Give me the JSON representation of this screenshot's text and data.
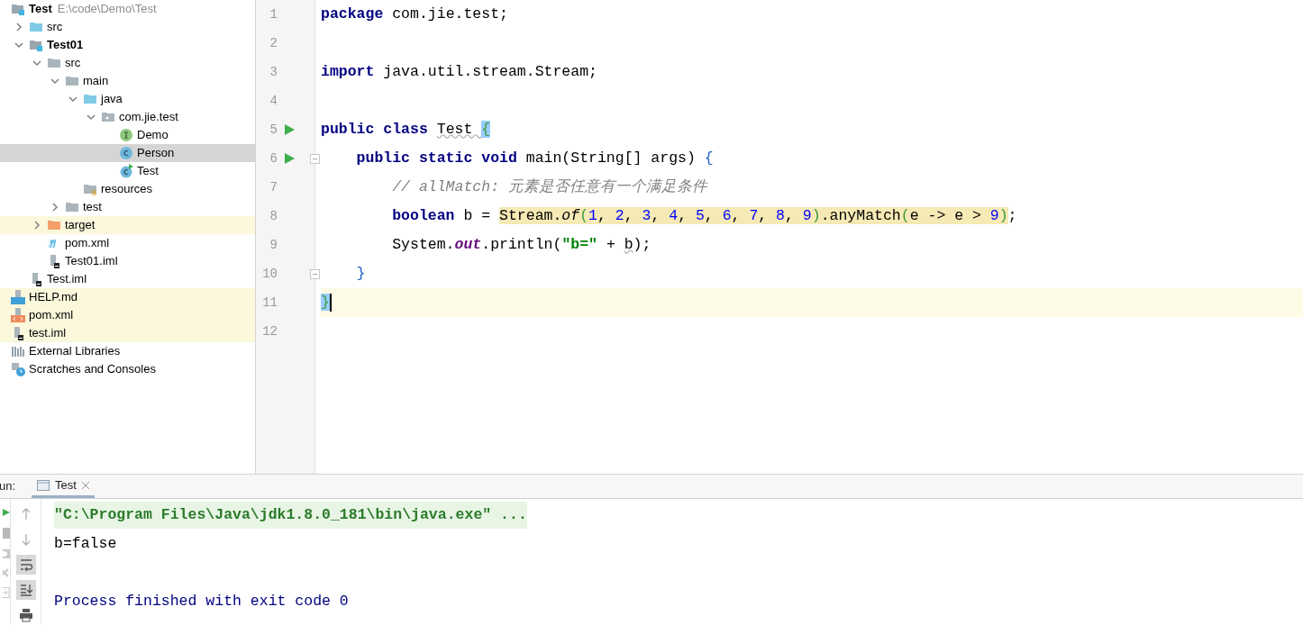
{
  "project_tree": [
    {
      "label": "Test",
      "kind": "module",
      "bold": true,
      "hint": "E:\\code\\Demo\\Test",
      "selected": false,
      "highlighted": false,
      "children": [
        {
          "label": "src",
          "kind": "source-folder",
          "bold": false,
          "expanded": false,
          "selected": false,
          "highlighted": false
        },
        {
          "label": "Test01",
          "kind": "module",
          "bold": true,
          "expanded": true,
          "selected": false,
          "highlighted": false,
          "children": [
            {
              "label": "src",
              "kind": "folder",
              "bold": false,
              "expanded": true,
              "selected": false,
              "highlighted": false,
              "children": [
                {
                  "label": "main",
                  "kind": "folder",
                  "bold": false,
                  "expanded": true,
                  "selected": false,
                  "highlighted": false,
                  "children": [
                    {
                      "label": "java",
                      "kind": "source-folder",
                      "bold": false,
                      "expanded": true,
                      "selected": false,
                      "highlighted": false,
                      "children": [
                        {
                          "label": "com.jie.test",
                          "kind": "package",
                          "bold": false,
                          "expanded": true,
                          "selected": false,
                          "highlighted": false,
                          "children": [
                            {
                              "label": "Demo",
                              "kind": "interface",
                              "bold": false,
                              "selected": false,
                              "highlighted": false
                            },
                            {
                              "label": "Person",
                              "kind": "class",
                              "bold": false,
                              "selected": true,
                              "highlighted": false
                            },
                            {
                              "label": "Test",
                              "kind": "class-run",
                              "bold": false,
                              "selected": false,
                              "highlighted": false
                            }
                          ]
                        }
                      ]
                    },
                    {
                      "label": "resources",
                      "kind": "resources",
                      "bold": false,
                      "selected": false,
                      "highlighted": false
                    }
                  ]
                },
                {
                  "label": "test",
                  "kind": "folder",
                  "bold": false,
                  "expanded": false,
                  "selected": false,
                  "highlighted": false
                }
              ]
            },
            {
              "label": "target",
              "kind": "excluded-folder",
              "bold": false,
              "expanded": false,
              "selected": false,
              "highlighted": true
            },
            {
              "label": "pom.xml",
              "kind": "maven",
              "bold": false,
              "selected": false,
              "highlighted": false
            },
            {
              "label": "Test01.iml",
              "kind": "iml",
              "bold": false,
              "selected": false,
              "highlighted": false
            }
          ]
        },
        {
          "label": "Test.iml",
          "kind": "iml",
          "bold": false,
          "selected": false,
          "highlighted": false
        }
      ]
    },
    {
      "label": "HELP.md",
      "kind": "markdown",
      "bold": false,
      "selected": false,
      "highlighted": true
    },
    {
      "label": "pom.xml",
      "kind": "xml",
      "bold": false,
      "selected": false,
      "highlighted": true
    },
    {
      "label": "test.iml",
      "kind": "iml",
      "bold": false,
      "selected": false,
      "highlighted": true
    },
    {
      "label": "External Libraries",
      "kind": "libraries",
      "bold": false,
      "selected": false,
      "highlighted": false
    },
    {
      "label": "Scratches and Consoles",
      "kind": "scratches",
      "bold": false,
      "selected": false,
      "highlighted": false
    }
  ],
  "editor": {
    "lines": [
      {
        "number": "1",
        "run": false,
        "fold": false,
        "current": false,
        "tokens": [
          {
            "kind": "kw",
            "text": "package "
          },
          {
            "kind": "plain",
            "text": "com.jie.test;"
          }
        ]
      },
      {
        "number": "2",
        "run": false,
        "fold": false,
        "current": false
      },
      {
        "number": "3",
        "run": false,
        "fold": false,
        "current": false,
        "tokens": [
          {
            "kind": "kw",
            "text": "import "
          },
          {
            "kind": "plain",
            "text": "java.util.stream.Stream;"
          }
        ]
      },
      {
        "number": "4",
        "run": false,
        "fold": false,
        "current": false
      },
      {
        "number": "5",
        "run": true,
        "fold": false,
        "current": false,
        "tokens": [
          {
            "kind": "kw",
            "text": "public class "
          },
          {
            "kind": "warn",
            "text": "Test "
          },
          {
            "kind": "brace-match",
            "text": "{"
          }
        ]
      },
      {
        "number": "6",
        "run": true,
        "fold": true,
        "current": false,
        "tokens": [
          {
            "kind": "kw",
            "text": "    public static void"
          },
          {
            "kind": "plain",
            "text": " main(String[] args) "
          },
          {
            "kind": "blue",
            "text": "{"
          }
        ]
      },
      {
        "number": "7",
        "run": false,
        "fold": false,
        "current": false,
        "tokens": [
          {
            "kind": "comment",
            "text": "        // allMatch: 元素是否任意有一个满足条件"
          }
        ]
      },
      {
        "number": "8",
        "run": false,
        "fold": false,
        "current": false,
        "tokens": [
          {
            "kind": "kw",
            "text": "        boolean"
          },
          {
            "kind": "plain",
            "text": " b = "
          },
          {
            "kind": "highlighted",
            "tokens": [
              {
                "kind": "plain",
                "text": "Stream."
              },
              {
                "kind": "italic",
                "text": "of"
              },
              {
                "kind": "green",
                "text": "("
              },
              {
                "kind": "num",
                "text": "1"
              },
              {
                "kind": "plain",
                "text": ", "
              },
              {
                "kind": "num",
                "text": "2"
              },
              {
                "kind": "plain",
                "text": ", "
              },
              {
                "kind": "num",
                "text": "3"
              },
              {
                "kind": "plain",
                "text": ", "
              },
              {
                "kind": "num",
                "text": "4"
              },
              {
                "kind": "plain",
                "text": ", "
              },
              {
                "kind": "num",
                "text": "5"
              },
              {
                "kind": "plain",
                "text": ", "
              },
              {
                "kind": "num",
                "text": "6"
              },
              {
                "kind": "plain",
                "text": ", "
              },
              {
                "kind": "num",
                "text": "7"
              },
              {
                "kind": "plain",
                "text": ", "
              },
              {
                "kind": "num",
                "text": "8"
              },
              {
                "kind": "plain",
                "text": ", "
              },
              {
                "kind": "num",
                "text": "9"
              },
              {
                "kind": "green",
                "text": ")"
              },
              {
                "kind": "plain",
                "text": ".anyMatch"
              },
              {
                "kind": "green",
                "text": "("
              },
              {
                "kind": "plain",
                "text": "e -> e > "
              },
              {
                "kind": "num",
                "text": "9"
              },
              {
                "kind": "green",
                "text": ")"
              }
            ]
          },
          {
            "kind": "plain",
            "text": ";"
          }
        ]
      },
      {
        "number": "9",
        "run": false,
        "fold": false,
        "current": false,
        "tokens": [
          {
            "kind": "plain",
            "text": "        System."
          },
          {
            "kind": "field",
            "text": "out"
          },
          {
            "kind": "plain",
            "text": ".println("
          },
          {
            "kind": "str",
            "text": "\"b=\""
          },
          {
            "kind": "plain",
            "text": " + "
          },
          {
            "kind": "warn",
            "text": "b"
          },
          {
            "kind": "plain",
            "text": ");"
          }
        ]
      },
      {
        "number": "10",
        "run": false,
        "fold": true,
        "current": false,
        "tokens": [
          {
            "kind": "blue",
            "text": "    }"
          }
        ]
      },
      {
        "number": "11",
        "run": false,
        "fold": false,
        "current": true,
        "tokens": [
          {
            "kind": "brace-match",
            "text": "}"
          }
        ]
      },
      {
        "number": "12",
        "run": false,
        "fold": false,
        "current": false
      }
    ]
  },
  "run_panel": {
    "label": "un:",
    "tab": {
      "label": "Test",
      "selected": true
    },
    "console": [
      {
        "kind": "command",
        "text": "\"C:\\Program Files\\Java\\jdk1.8.0_181\\bin\\java.exe\" ..."
      },
      {
        "kind": "output",
        "text": "b=false"
      },
      {
        "kind": "system",
        "text": "Process finished with exit code 0"
      }
    ]
  }
}
